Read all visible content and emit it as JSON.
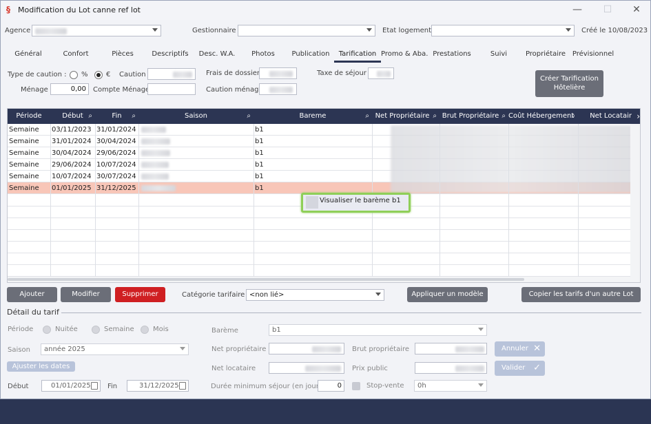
{
  "window": {
    "title": "Modification du Lot canne ref lot",
    "app_icon": "app-logo-icon",
    "controls": {
      "minimize": "—",
      "maximize": "☐",
      "close": "✕"
    }
  },
  "header": {
    "agence_label": "Agence",
    "gestionnaire_label": "Gestionnaire",
    "etat_logement_label": "Etat logement",
    "created": "Créé le 10/08/2023"
  },
  "tabs": [
    "Général",
    "Confort",
    "Pièces",
    "Descriptifs",
    "Desc. W.A.",
    "Photos",
    "Publication",
    "Tarification",
    "Promo & Aba.",
    "Prestations",
    "Suivi",
    "Propriétaire",
    "Prévisionnel"
  ],
  "active_tab": "Tarification",
  "caution": {
    "type_label": "Type de caution :",
    "percent_label": "%",
    "euro_label": "€",
    "caution_label": "Caution",
    "frais_label": "Frais de dossier",
    "taxe_label": "Taxe de séjour",
    "menage_label": "Ménage",
    "menage_value": "0,00",
    "compte_menage_label": "Compte Ménage",
    "caution_menage_label": "Caution ménage",
    "creer_button": "Créer Tarification\nHôtelière"
  },
  "grid": {
    "columns": [
      "Période",
      "Début",
      "Fin",
      "Saison",
      "Bareme",
      "Net Propriétaire",
      "Brut Propriétaire",
      "Coût Hébergement",
      "Net Locatair"
    ],
    "rows": [
      {
        "periode": "Semaine",
        "debut": "03/11/2023",
        "fin": "31/01/2024",
        "bareme": "b1"
      },
      {
        "periode": "Semaine",
        "debut": "31/01/2024",
        "fin": "30/04/2024",
        "bareme": "b1"
      },
      {
        "periode": "Semaine",
        "debut": "30/04/2024",
        "fin": "29/06/2024",
        "bareme": "b1"
      },
      {
        "periode": "Semaine",
        "debut": "29/06/2024",
        "fin": "10/07/2024",
        "bareme": "b1"
      },
      {
        "periode": "Semaine",
        "debut": "10/07/2024",
        "fin": "30/07/2024",
        "bareme": "b1"
      },
      {
        "periode": "Semaine",
        "debut": "01/01/2025",
        "fin": "31/12/2025",
        "bareme": "b1"
      }
    ],
    "selected_row": 5,
    "context_menu": "Visualiser le barème b1",
    "scroll_right": "›"
  },
  "actions": {
    "ajouter": "Ajouter",
    "modifier": "Modifier",
    "supprimer": "Supprimer",
    "categorie_label": "Catégorie tarifaire",
    "categorie_value": "<non lié>",
    "appliquer": "Appliquer un modèle",
    "copier": "Copier les tarifs d'un autre Lot"
  },
  "detail": {
    "title": "Détail du tarif",
    "periode_label": "Période",
    "nuitee": "Nuitée",
    "semaine": "Semaine",
    "mois": "Mois",
    "saison_label": "Saison",
    "saison_value": "année 2025",
    "ajuster": "Ajuster les dates",
    "debut_label": "Début",
    "debut_value": "01/01/2025",
    "fin_label": "Fin",
    "fin_value": "31/12/2025",
    "bareme_label": "Barème",
    "bareme_value": "b1",
    "net_proprio_label": "Net propriétaire",
    "brut_proprio_label": "Brut propriétaire",
    "net_locataire_label": "Net locataire",
    "prix_public_label": "Prix public",
    "duree_label": "Durée minimum séjour (en jours)",
    "duree_value": "0",
    "stop_vente_label": "Stop-vente",
    "stop_vente_value": "0h",
    "annuler": "Annuler",
    "annuler_icon": "✕",
    "valider": "Valider",
    "valider_icon": "✓"
  }
}
